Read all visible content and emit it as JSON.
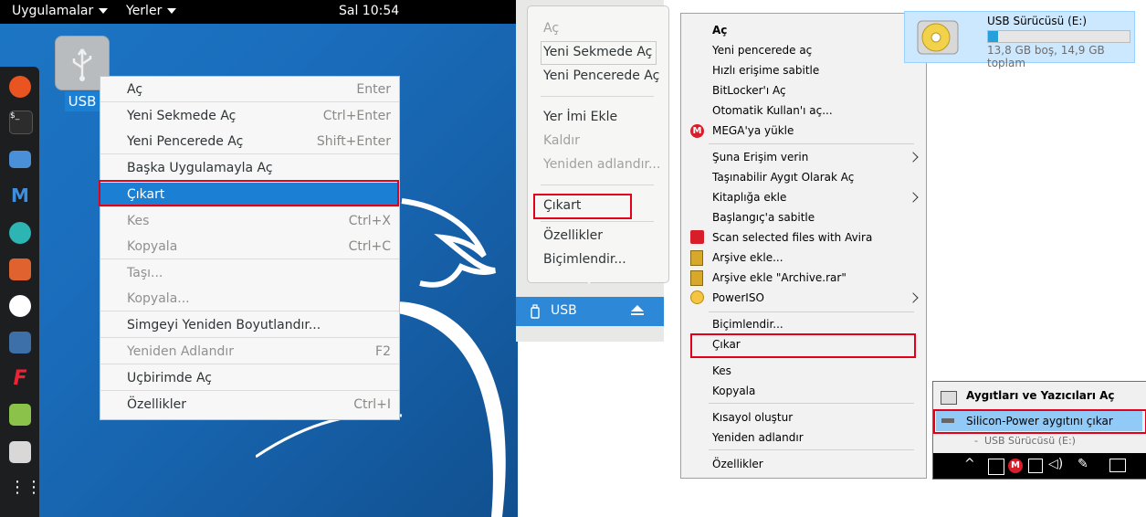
{
  "kali": {
    "topbar": {
      "apps_menu": "Uygulamalar",
      "places_menu": "Yerler",
      "clock": "Sal 10:54"
    },
    "desktop_icon_label": "USB",
    "menu": [
      {
        "label": "Aç",
        "shortcut": "Enter",
        "enabled": true
      },
      {
        "label": "Yeni Sekmede Aç",
        "shortcut": "Ctrl+Enter",
        "enabled": true
      },
      {
        "label": "Yeni Pencerede Aç",
        "shortcut": "Shift+Enter",
        "enabled": true
      },
      {
        "label": "Başka Uygulamayla Aç",
        "shortcut": "",
        "enabled": true
      },
      {
        "label": "Çıkart",
        "shortcut": "",
        "enabled": true,
        "selected": true
      },
      {
        "label": "Kes",
        "shortcut": "Ctrl+X",
        "enabled": false
      },
      {
        "label": "Kopyala",
        "shortcut": "Ctrl+C",
        "enabled": false
      },
      {
        "label": "Taşı...",
        "shortcut": "",
        "enabled": false
      },
      {
        "label": "Kopyala...",
        "shortcut": "",
        "enabled": false
      },
      {
        "label": "Simgeyi Yeniden Boyutlandır...",
        "shortcut": "",
        "enabled": true
      },
      {
        "label": "Yeniden Adlandır",
        "shortcut": "F2",
        "enabled": false
      },
      {
        "label": "Uçbirimde Aç",
        "shortcut": "",
        "enabled": true
      },
      {
        "label": "Özellikler",
        "shortcut": "Ctrl+I",
        "enabled": true
      }
    ]
  },
  "gtk": {
    "items": [
      "Aç",
      "Yeni Sekmede Aç",
      "Yeni Pencerede Aç",
      "Yer İmi Ekle",
      "Kaldır",
      "Yeniden adlandır...",
      "Çıkart",
      "Özellikler",
      "Biçimlendir..."
    ],
    "sidebar_item": "USB"
  },
  "win": {
    "items": [
      "Aç",
      "Yeni pencerede aç",
      "Hızlı erişime sabitle",
      "BitLocker'ı Aç",
      "Otomatik Kullan'ı aç...",
      "MEGA'ya yükle",
      "Şuna Erişim verin",
      "Taşınabilir Aygıt Olarak Aç",
      "Kitaplığa ekle",
      "Başlangıç'a sabitle",
      "Scan selected files with Avira",
      "Arşive ekle...",
      "Arşive ekle \"Archive.rar\"",
      "PowerISO",
      "Biçimlendir...",
      "Çıkar",
      "Kes",
      "Kopyala",
      "Kısayol oluştur",
      "Yeniden adlandır",
      "Özellikler"
    ]
  },
  "drive": {
    "name": "USB Sürücüsü (E:)",
    "free_text": "13,8 GB boş, 14,9 GB toplam",
    "used_fraction": 0.074
  },
  "tray": {
    "header": "Aygıtları ve Yazıcıları Aç",
    "eject": "Silicon-Power aygıtını çıkar",
    "sub": "USB Sürücüsü (E:)"
  },
  "colors": {
    "kali_select": "#1b7fd4",
    "highlight_red": "#e2001a",
    "win_select": "#91c9f7"
  }
}
